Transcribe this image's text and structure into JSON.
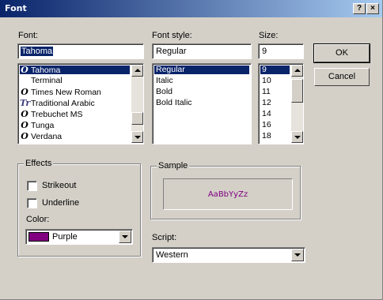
{
  "window": {
    "title": "Font",
    "help_button": "?",
    "close_button": "×"
  },
  "font": {
    "label": "Font:",
    "value": "Tahoma",
    "items": [
      {
        "name": "Tahoma",
        "icon": "O",
        "selected": true
      },
      {
        "name": "Terminal",
        "icon": "",
        "selected": false
      },
      {
        "name": "Times New Roman",
        "icon": "O",
        "selected": false
      },
      {
        "name": "Traditional Arabic",
        "icon": "Tr",
        "selected": false
      },
      {
        "name": "Trebuchet MS",
        "icon": "O",
        "selected": false
      },
      {
        "name": "Tunga",
        "icon": "O",
        "selected": false
      },
      {
        "name": "Verdana",
        "icon": "O",
        "selected": false
      }
    ]
  },
  "style": {
    "label": "Font style:",
    "value": "Regular",
    "items": [
      {
        "name": "Regular",
        "selected": true
      },
      {
        "name": "Italic",
        "selected": false
      },
      {
        "name": "Bold",
        "selected": false
      },
      {
        "name": "Bold Italic",
        "selected": false
      }
    ]
  },
  "size": {
    "label": "Size:",
    "value": "9",
    "items": [
      {
        "name": "9",
        "selected": true
      },
      {
        "name": "10",
        "selected": false
      },
      {
        "name": "11",
        "selected": false
      },
      {
        "name": "12",
        "selected": false
      },
      {
        "name": "14",
        "selected": false
      },
      {
        "name": "16",
        "selected": false
      },
      {
        "name": "18",
        "selected": false
      }
    ]
  },
  "buttons": {
    "ok": "OK",
    "cancel": "Cancel"
  },
  "effects": {
    "title": "Effects",
    "strikeout": "Strikeout",
    "underline": "Underline",
    "color_label": "Color:",
    "color_value": "Purple",
    "color_swatch": "#800080"
  },
  "sample": {
    "title": "Sample",
    "text": "AaBbYyZz",
    "text_color": "#800080"
  },
  "script": {
    "label": "Script:",
    "value": "Western"
  },
  "colors": {
    "face": "#d4d0c8",
    "highlight": "#0a246a",
    "title_gradient_end": "#a6caf0"
  }
}
